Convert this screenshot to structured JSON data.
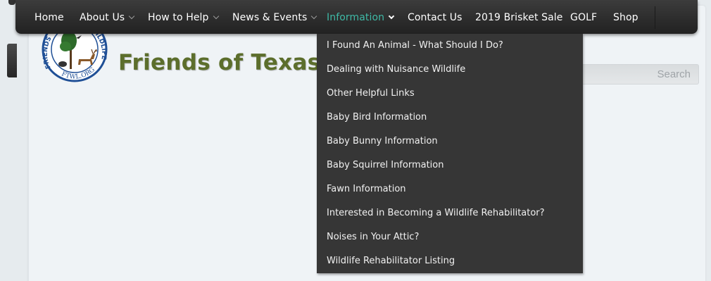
{
  "nav": {
    "items": [
      {
        "label": "Home",
        "has_caret": false
      },
      {
        "label": "About Us",
        "has_caret": true
      },
      {
        "label": "How to Help",
        "has_caret": true
      },
      {
        "label": "News & Events",
        "has_caret": true
      },
      {
        "label": "Information",
        "has_caret": true,
        "active": true
      },
      {
        "label": "Contact Us",
        "has_caret": false
      },
      {
        "label": "2019 Brisket Sale",
        "has_caret": false
      },
      {
        "label": "GOLF",
        "has_caret": false
      },
      {
        "label": "Shop",
        "has_caret": false
      }
    ],
    "active_color": "#3fb9a6"
  },
  "dropdown": {
    "items": [
      "I Found An Animal - What Should I Do?",
      "Dealing with Nuisance Wildlife",
      "Other Helpful Links",
      "Baby Bird Information",
      "Baby Bunny Information",
      "Baby Squirrel Information",
      "Fawn Information",
      "Interested in Becoming a Wildlife Rehabilitator?",
      "Noises in Your Attic?",
      "Wildlife Rehabilitator Listing"
    ]
  },
  "header": {
    "site_title": "Friends of Texas W",
    "title_color": "#5c6e2c",
    "logo_ring_text_left": "FRIENDS",
    "logo_ring_text_right": "WILDLIFE",
    "logo_ring_text_bottom": "FTWL.ORG"
  },
  "search": {
    "placeholder": "Search"
  }
}
